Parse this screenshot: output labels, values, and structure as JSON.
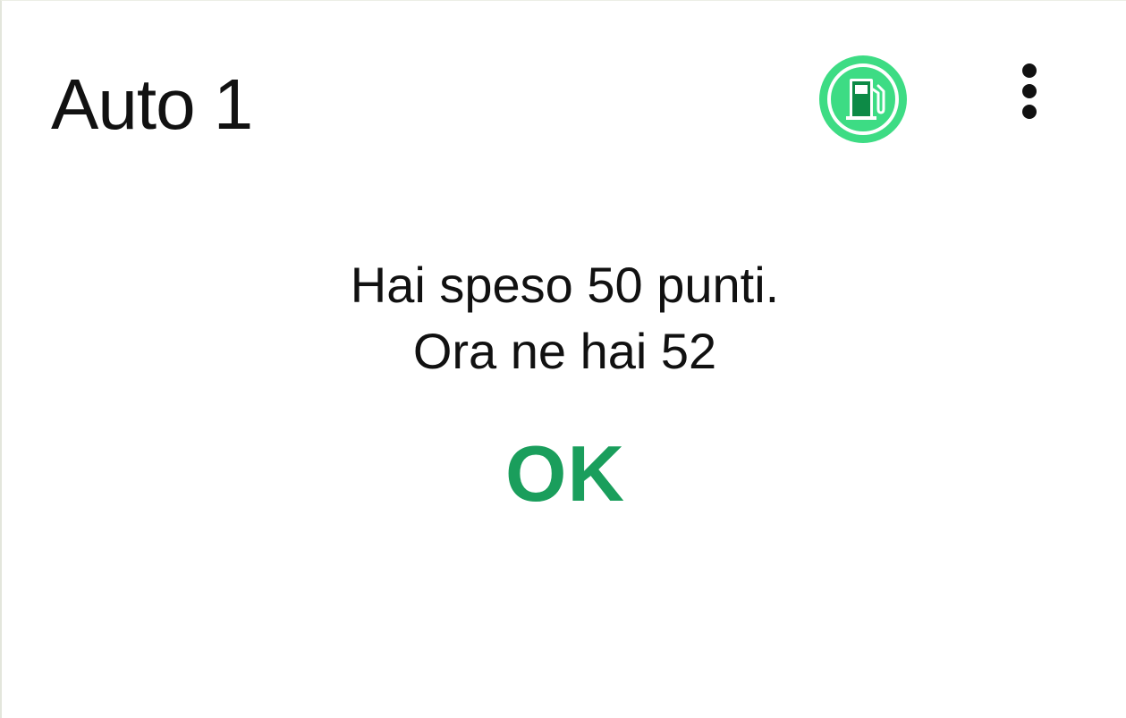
{
  "header": {
    "title": "Auto 1",
    "fuel_icon": "fuel-pump-icon",
    "more_icon": "more-vertical-icon"
  },
  "dialog": {
    "message_line1": "Hai speso 50 punti.",
    "message_line2": "Ora ne hai 52",
    "ok_label": "OK"
  },
  "colors": {
    "accent": "#1a9e5c",
    "badge_green": "#3ddc84",
    "icon_dark_green": "#0d8a46"
  }
}
